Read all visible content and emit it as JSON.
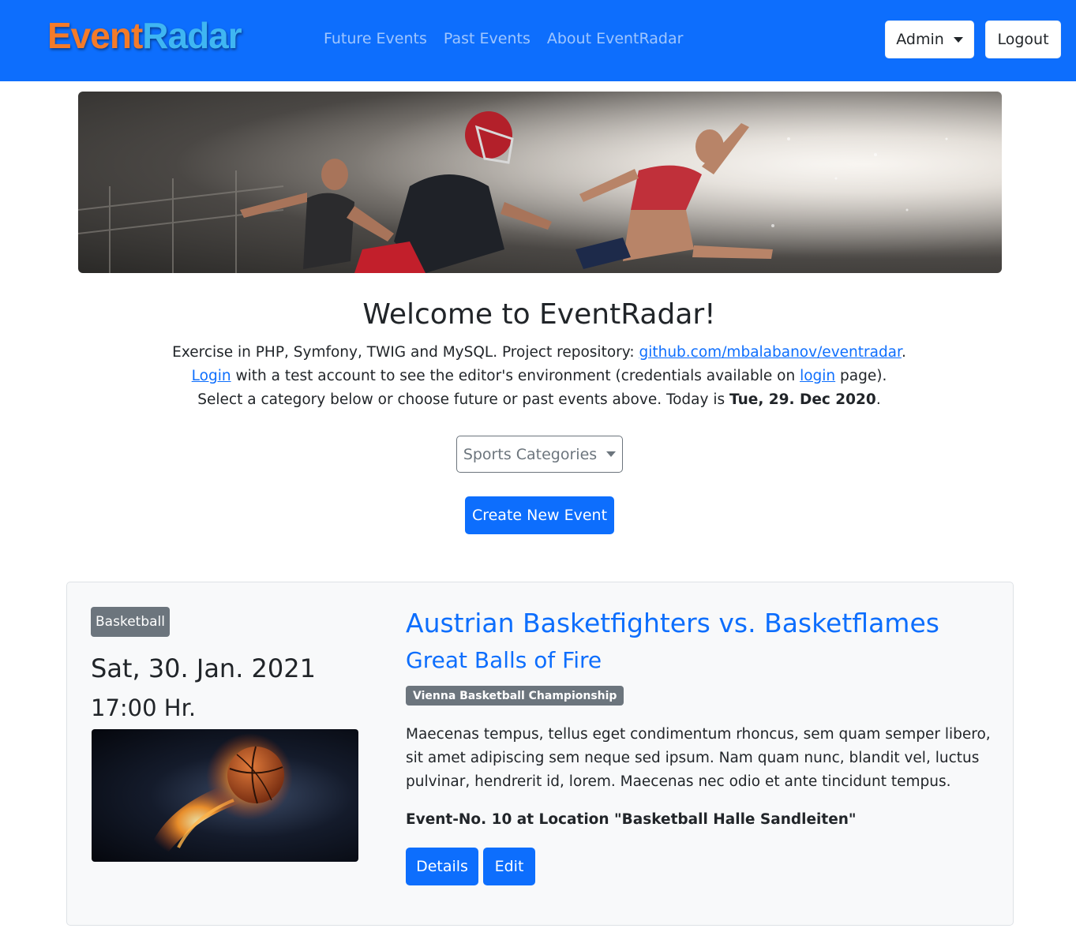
{
  "brand": {
    "part1": "Event",
    "part2": "Radar"
  },
  "nav": {
    "links": [
      "Future Events",
      "Past Events",
      "About EventRadar"
    ],
    "admin_label": "Admin",
    "logout_label": "Logout"
  },
  "welcome": {
    "title": "Welcome to EventRadar!",
    "line1_text": "Exercise in PHP, Symfony, TWIG and MySQL. Project repository: ",
    "line1_link": "github.com/mbalabanov/eventradar",
    "line1_end": ".",
    "line2_link1": "Login",
    "line2_text": " with a test account to see the editor's environment (credentials available on ",
    "line2_link2": "login",
    "line2_end": " page).",
    "line3_text": "Select a category below or choose future or past events above. Today is ",
    "line3_date": "Tue, 29. Dec 2020",
    "line3_end": "."
  },
  "category_dropdown": {
    "label": "Sports Categories"
  },
  "create_button": {
    "label": "Create New Event"
  },
  "event": {
    "category": "Basketball",
    "date": "Sat, 30. Jan. 2021",
    "time": "17:00 Hr.",
    "title": "Austrian Basketfighters vs. Basketflames",
    "subtitle": "Great Balls of Fire",
    "championship": "Vienna Basketball Championship",
    "description": "Maecenas tempus, tellus eget condimentum rhoncus, sem quam semper libero, sit amet adipiscing sem neque sed ipsum. Nam quam nunc, blandit vel, luctus pulvinar, hendrerit id, lorem. Maecenas nec odio et ante tincidunt tempus.",
    "location": "Event-No. 10 at Location \"Basketball Halle Sandleiten\"",
    "details_label": "Details",
    "edit_label": "Edit"
  },
  "colors": {
    "primary": "#0d6efd",
    "secondary": "#6c757d",
    "brand_orange": "#f47b2a",
    "brand_blue": "#3fb6f2"
  }
}
